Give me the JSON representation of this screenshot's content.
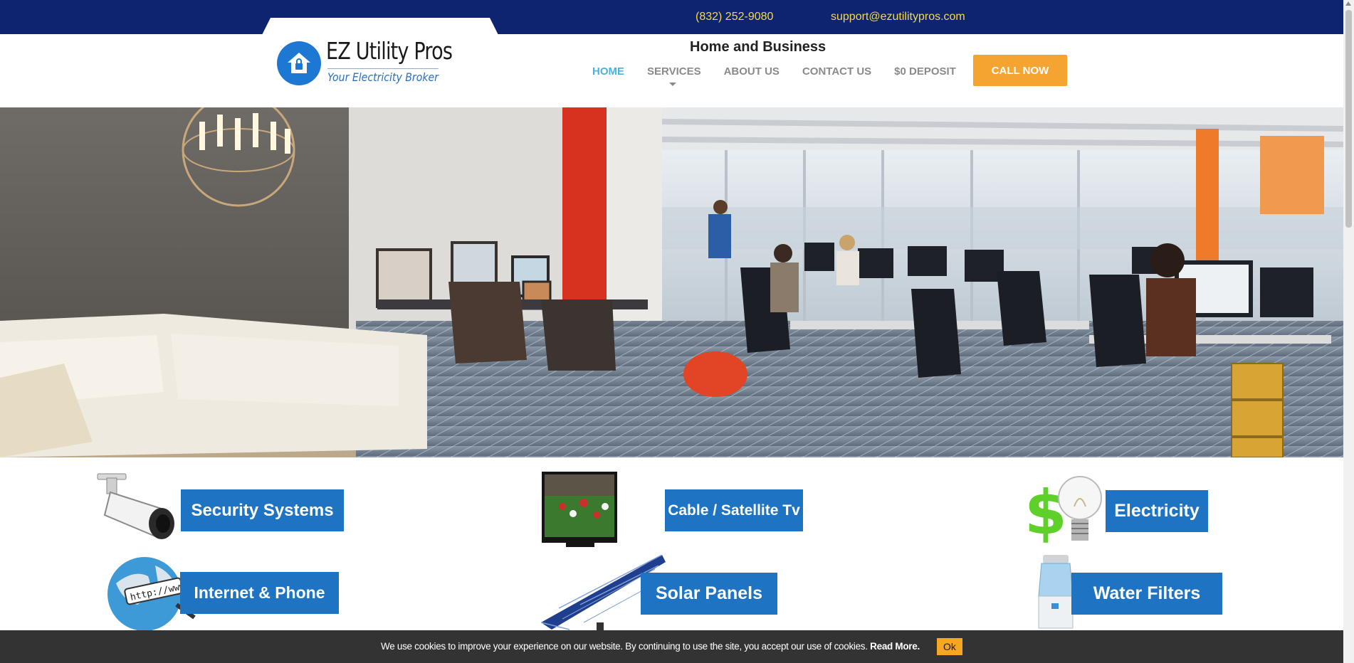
{
  "topbar": {
    "phone": "(832) 252-9080",
    "email": "support@ezutilitypros.com",
    "background": "#0e2471",
    "text_color": "#f5d94a"
  },
  "logo": {
    "title": "EZ Utility Pros",
    "subtitle": "Your Electricity Broker",
    "icon": "house-lock-icon",
    "color": "#1d78d3"
  },
  "header": {
    "tagline": "Home and Business",
    "nav": [
      {
        "label": "HOME",
        "active": true
      },
      {
        "label": "SERVICES",
        "active": false,
        "has_dropdown": true
      },
      {
        "label": "ABOUT US",
        "active": false
      },
      {
        "label": "CONTACT US",
        "active": false
      },
      {
        "label": "$0 DEPOSIT",
        "active": false
      }
    ],
    "call_button": "CALL NOW",
    "accent": "#f5a431"
  },
  "hero": {
    "image": "office-interior-photo"
  },
  "services": [
    {
      "label": "Security Systems",
      "icon": "security-camera-icon"
    },
    {
      "label": "Cable / Satellite Tv",
      "icon": "television-icon"
    },
    {
      "label": "Electricity",
      "icon": "dollar-lightbulb-icon"
    },
    {
      "label": "Internet & Phone",
      "icon": "globe-www-icon"
    },
    {
      "label": "Solar Panels",
      "icon": "solar-panel-icon"
    },
    {
      "label": "Water Filters",
      "icon": "water-dispenser-icon"
    }
  ],
  "cookie": {
    "text": "We use cookies to improve your experience on our website. By continuing to use the site, you accept our use of cookies.",
    "link": "Read More.",
    "ok": "Ok"
  }
}
